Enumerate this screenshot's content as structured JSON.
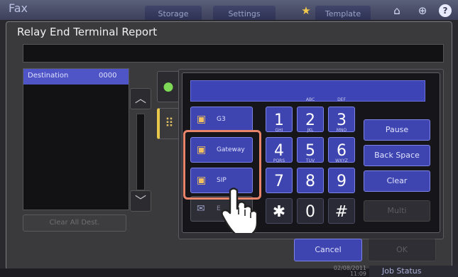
{
  "app": {
    "title": "Fax",
    "tabs": [
      "Storage",
      "Settings",
      "Template"
    ],
    "icons": [
      "star-icon",
      "home-icon",
      "globe-icon",
      "help-icon"
    ]
  },
  "dialog": {
    "title": "Relay End Terminal Report",
    "text_value": "",
    "list": {
      "header": "Destination",
      "count": "0000",
      "clear_all": "Clear All Dest."
    },
    "types": {
      "g3": "G3",
      "gateway": "Gateway",
      "sip": "SIP",
      "email": "E"
    },
    "keypad": [
      {
        "digit": "1",
        "letters": ""
      },
      {
        "digit": "2",
        "letters": "ABC"
      },
      {
        "digit": "3",
        "letters": "DEF"
      },
      {
        "digit": "4",
        "letters": "GHI"
      },
      {
        "digit": "5",
        "letters": "JKL"
      },
      {
        "digit": "6",
        "letters": "MNO"
      },
      {
        "digit": "7",
        "letters": "PQRS"
      },
      {
        "digit": "8",
        "letters": "TUV"
      },
      {
        "digit": "9",
        "letters": "WXYZ"
      },
      {
        "digit": "✱",
        "letters": ""
      },
      {
        "digit": "0",
        "letters": ""
      },
      {
        "digit": "#",
        "letters": ""
      }
    ],
    "functions": {
      "pause": "Pause",
      "backspace": "Back Space",
      "clear": "Clear",
      "multi": "Multi"
    },
    "cancel": "Cancel",
    "ok": "OK"
  },
  "status": {
    "date": "02/08/2011",
    "time": "11:09",
    "job_status": "Job Status"
  },
  "colors": {
    "accent": "#3f45b0",
    "highlight": "#e8846a",
    "background": "#3a3a3d"
  }
}
